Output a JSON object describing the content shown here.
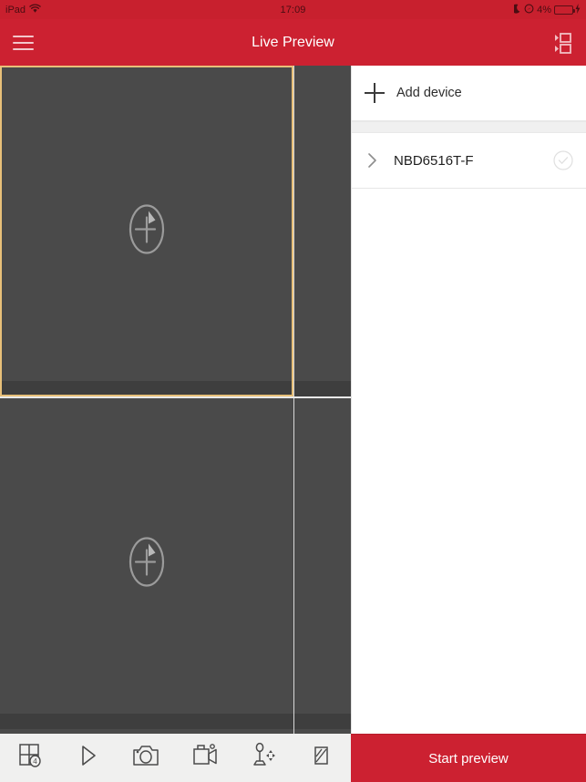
{
  "statusbar": {
    "device_label": "iPad",
    "wifi_icon": "wifi-icon",
    "time": "17:09",
    "do_not_disturb_icon": "moon-icon",
    "location_icon": "location-icon",
    "battery_percent": "4%",
    "battery_icon": "battery-icon",
    "charging_icon": "lightning-bolt-icon"
  },
  "navbar": {
    "menu_icon": "hamburger-menu-icon",
    "title": "Live Preview",
    "layout_icon": "device-split-layout-icon"
  },
  "video_grid": {
    "placeholder_icon": "add-camera-icon",
    "selected_cell_index": 0,
    "selection_color": "#e8c079",
    "cell_background": "#4a4a4a",
    "cells": [
      {
        "id": "cell-1",
        "selected": true,
        "empty": true
      },
      {
        "id": "cell-2",
        "selected": false,
        "empty": true
      },
      {
        "id": "cell-3",
        "selected": false,
        "empty": true
      },
      {
        "id": "cell-4",
        "selected": false,
        "empty": true
      }
    ]
  },
  "device_panel": {
    "add_device": {
      "label": "Add device",
      "icon": "plus-icon"
    },
    "devices": [
      {
        "name": "NBD6516T-F",
        "expand_icon": "chevron-right-icon",
        "select_icon": "circle-check-icon",
        "selected": false
      }
    ]
  },
  "toolbar": {
    "buttons": [
      {
        "name": "split-screen-4-button",
        "icon": "grid-four-split-icon",
        "badge": "4"
      },
      {
        "name": "play-button",
        "icon": "play-triangle-icon"
      },
      {
        "name": "snapshot-button",
        "icon": "camera-icon"
      },
      {
        "name": "record-button",
        "icon": "video-camera-icon"
      },
      {
        "name": "ptz-button",
        "icon": "ptz-joystick-icon"
      },
      {
        "name": "more-button",
        "icon": "partially-hidden-icon"
      }
    ]
  },
  "start_button": {
    "label": "Start preview",
    "color": "#cc2131"
  }
}
